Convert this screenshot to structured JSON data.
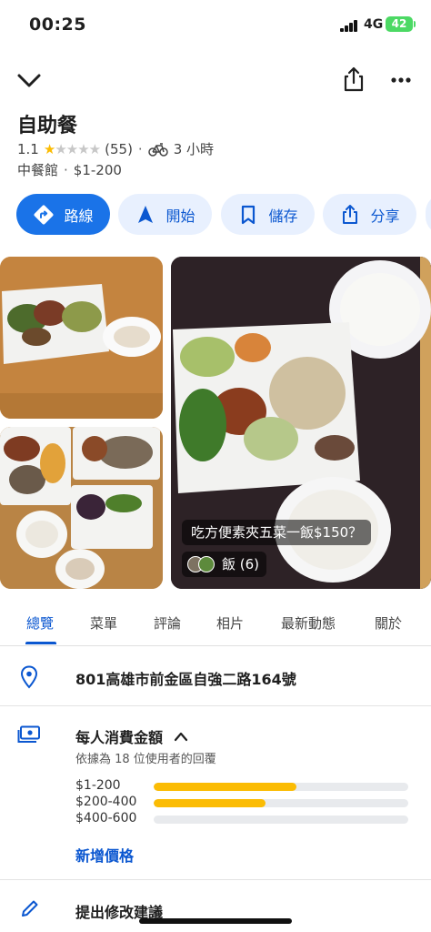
{
  "status_bar": {
    "time": "00:25",
    "network": "4G",
    "battery": "42"
  },
  "place": {
    "name": "自助餐",
    "rating": "1.1",
    "stars": 1,
    "review_count": "(55)",
    "travel_time": "3 小時",
    "category": "中餐館",
    "price_range": "$1-200"
  },
  "actions": [
    {
      "label": "路線",
      "icon": "directions-icon"
    },
    {
      "label": "開始",
      "icon": "navigation-icon"
    },
    {
      "label": "儲存",
      "icon": "bookmark-icon"
    },
    {
      "label": "分享",
      "icon": "share-icon"
    }
  ],
  "photos": {
    "caption": "吃方便素夾五菜一飯$150？",
    "tag_label": "飯 (6)"
  },
  "tabs": [
    "總覽",
    "菜單",
    "評論",
    "相片",
    "最新動態",
    "關於"
  ],
  "active_tab": 0,
  "address": "801高雄市前金區自強二路164號",
  "price_info": {
    "title": "每人消費金額",
    "subtitle": "依據為 18 位使用者的回覆",
    "bars": [
      {
        "label": "$1-200",
        "share": 0.56
      },
      {
        "label": "$200-400",
        "share": 0.44
      },
      {
        "label": "$400-600",
        "share": 0.0
      }
    ],
    "add_label": "新增價格"
  },
  "suggest_edit": "提出修改建議",
  "colors": {
    "accent": "#1a73e8",
    "accent_text": "#0b57d0",
    "star": "#fbbc04",
    "bar": "#fbbc04",
    "chip_bg": "#e8f0fe"
  }
}
